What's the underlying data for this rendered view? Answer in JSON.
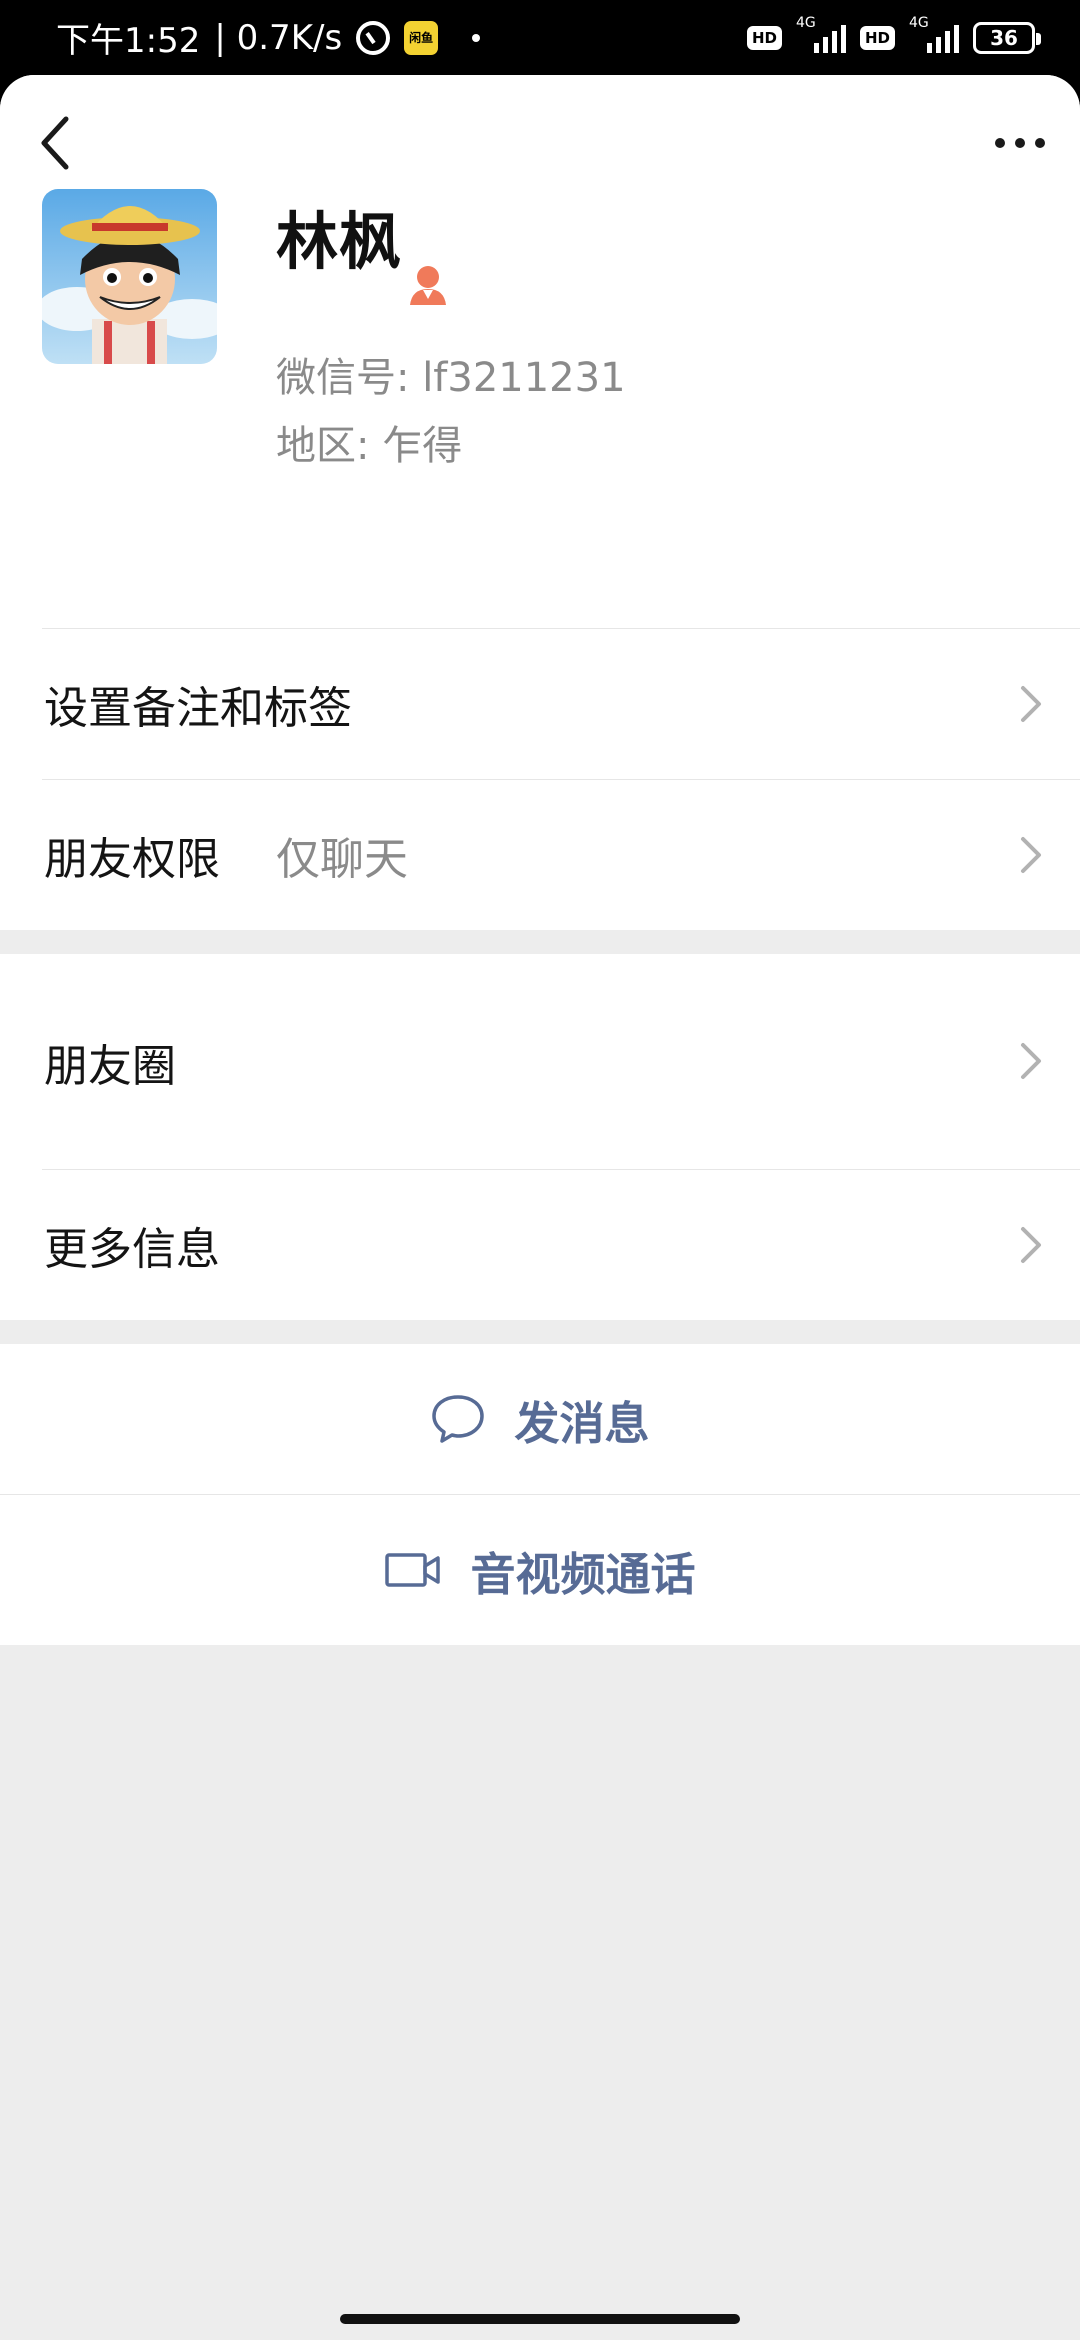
{
  "status_bar": {
    "time": "下午1:52",
    "speed": "| 0.7K/s",
    "app_icon_text": "闲鱼",
    "hd_label": "HD",
    "network_label": "4G",
    "battery": "36"
  },
  "profile": {
    "name": "林枫",
    "wechat_id": "微信号:  lf3211231",
    "region": "地区:  乍得"
  },
  "rows": {
    "remark": {
      "label": "设置备注和标签"
    },
    "permission": {
      "label": "朋友权限",
      "value": "仅聊天"
    },
    "moments": {
      "label": "朋友圈"
    },
    "more_info": {
      "label": "更多信息"
    }
  },
  "actions": {
    "message": "发消息",
    "call": "音视频通话"
  },
  "colors": {
    "link": "#576b95",
    "badge": "#f07a5a",
    "background": "#ededed"
  },
  "icons": [
    "back-icon",
    "more-icon",
    "contact-badge-icon",
    "chevron-right-icon",
    "chat-bubble-icon",
    "video-call-icon"
  ]
}
